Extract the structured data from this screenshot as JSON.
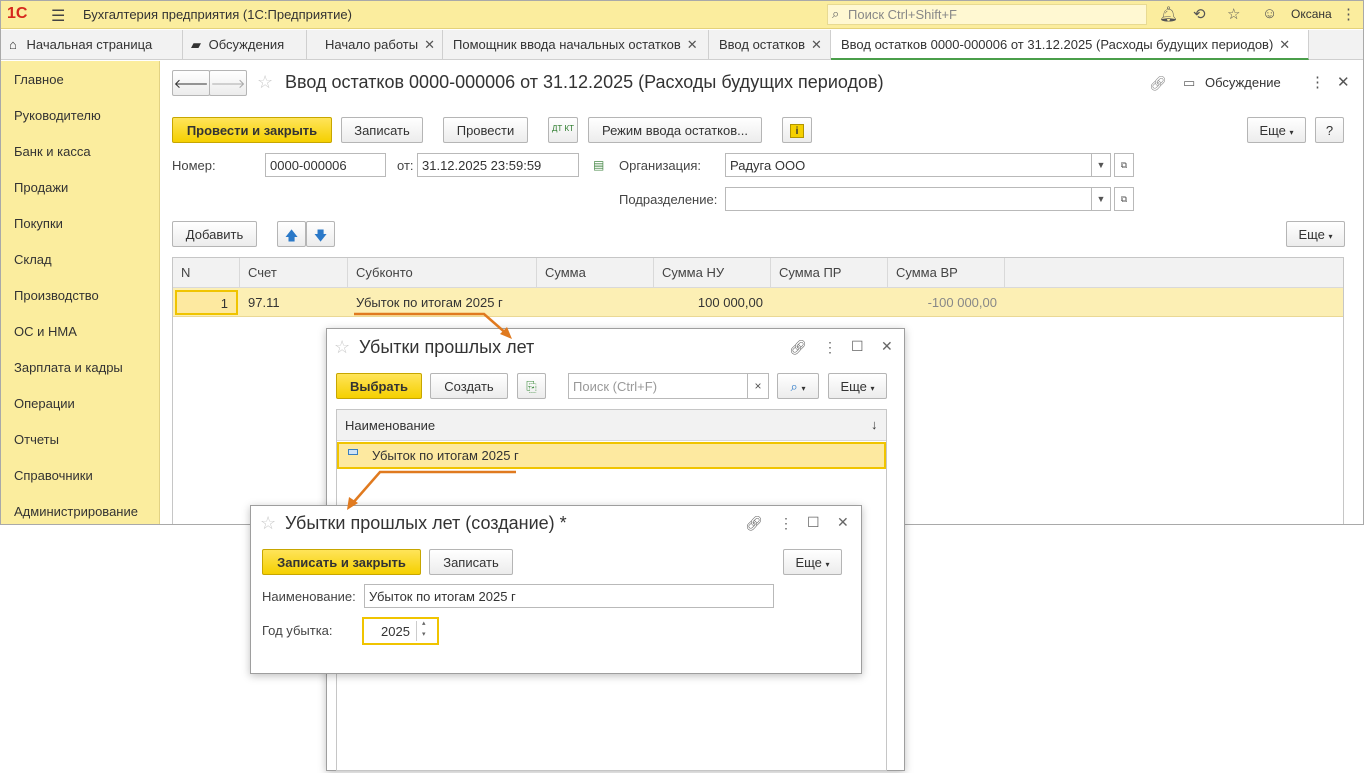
{
  "app": {
    "logo": "1С",
    "title": "Бухгалтерия предприятия  (1С:Предприятие)",
    "search_placeholder": "Поиск Ctrl+Shift+F",
    "user": "Оксана"
  },
  "tabs": [
    {
      "label": "Начальная страница"
    },
    {
      "label": "Обсуждения"
    },
    {
      "label": "Начало работы"
    },
    {
      "label": "Помощник ввода начальных остатков"
    },
    {
      "label": "Ввод остатков"
    },
    {
      "label": "Ввод остатков 0000-000006 от 31.12.2025 (Расходы будущих периодов)"
    }
  ],
  "sidebar": {
    "items": [
      {
        "label": "Главное"
      },
      {
        "label": "Руководителю"
      },
      {
        "label": "Банк и касса"
      },
      {
        "label": "Продажи"
      },
      {
        "label": "Покупки"
      },
      {
        "label": "Склад"
      },
      {
        "label": "Производство"
      },
      {
        "label": "ОС и НМА"
      },
      {
        "label": "Зарплата и кадры"
      },
      {
        "label": "Операции"
      },
      {
        "label": "Отчеты"
      },
      {
        "label": "Справочники"
      },
      {
        "label": "Администрирование"
      }
    ]
  },
  "document": {
    "title": "Ввод остатков 0000-000006 от 31.12.2025 (Расходы будущих периодов)",
    "discussion": "Обсуждение",
    "buttons": {
      "post_close": "Провести и закрыть",
      "save": "Записать",
      "post": "Провести",
      "dt_kt": "ДТ КТ",
      "mode": "Режим ввода остатков...",
      "more": "Еще",
      "help": "?",
      "add": "Добавить",
      "more2": "Еще"
    },
    "fields": {
      "number_label": "Номер:",
      "number_value": "0000-000006",
      "date_label": "от:",
      "date_value": "31.12.2025 23:59:59",
      "org_label": "Организация:",
      "org_value": "Радуга ООО",
      "div_label": "Подразделение:",
      "div_value": ""
    },
    "table": {
      "headers": [
        "N",
        "Счет",
        "Субконто",
        "Сумма",
        "Сумма НУ",
        "Сумма ПР",
        "Сумма ВР"
      ],
      "row": {
        "n": "1",
        "account": "97.11",
        "subconto": "Убыток по итогам 2025 г",
        "sum": "",
        "sum_nu": "100 000,00",
        "sum_pr": "",
        "sum_vr": "-100 000,00"
      }
    }
  },
  "picker": {
    "title": "Убытки прошлых лет",
    "select": "Выбрать",
    "create": "Создать",
    "search_placeholder": "Поиск (Ctrl+F)",
    "search_clear": "×",
    "more": "Еще",
    "column": "Наименование",
    "sort_arrow": "↓",
    "item": "Убыток по итогам 2025 г"
  },
  "create_form": {
    "title": "Убытки прошлых лет (создание) *",
    "save_close": "Записать и закрыть",
    "save": "Записать",
    "more": "Еще",
    "name_label": "Наименование:",
    "name_value": "Убыток по итогам 2025 г",
    "year_label": "Год убытка:",
    "year_value": "2025"
  },
  "colors": {
    "accent_yellow": "#f5d000",
    "sidebar": "#fbed9e",
    "selected_row": "#fcefb4",
    "arrow": "#e07a1f"
  }
}
